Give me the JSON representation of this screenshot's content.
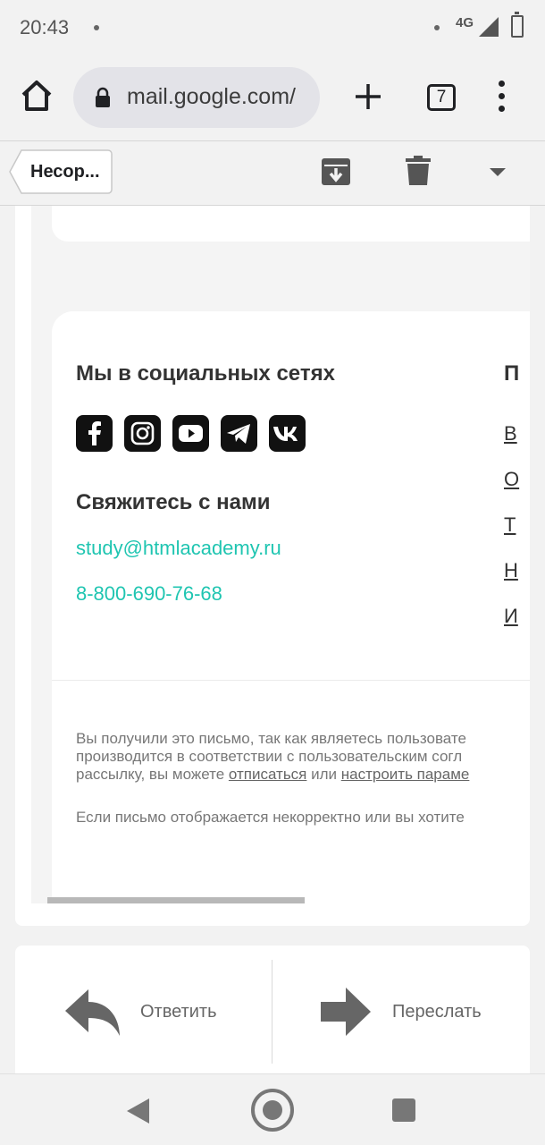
{
  "status_bar": {
    "time": "20:43",
    "network": "4G"
  },
  "browser": {
    "url": "mail.google.com/",
    "tab_count": "7"
  },
  "gmail_toolbar": {
    "back_label": "Несор..."
  },
  "email": {
    "social_title": "Мы в социальных сетях",
    "social_icons": [
      "facebook-icon",
      "instagram-icon",
      "youtube-icon",
      "telegram-icon",
      "vk-icon"
    ],
    "contact_title": "Свяжитесь с нами",
    "contact_email": "study@htmlacademy.ru",
    "contact_phone": "8-800-690-76-68",
    "right_column_heading": "П",
    "right_column_links": [
      "В",
      "О",
      "Т",
      "Н",
      "И"
    ],
    "disclaimer": {
      "line1": "Вы получили это письмо, так как являетесь пользовате",
      "line2": "производится в соответствии с пользовательским согл",
      "line3_prefix": "рассылку, вы можете ",
      "unsubscribe_link": "отписаться",
      "line3_middle": " или ",
      "settings_link": "настроить параме",
      "line4": "Если письмо отображается некорректно или вы хотите"
    }
  },
  "actions": {
    "reply_label": "Ответить",
    "forward_label": "Переслать"
  },
  "colors": {
    "accent": "#1fc5b1",
    "icon_bg": "#111111"
  }
}
